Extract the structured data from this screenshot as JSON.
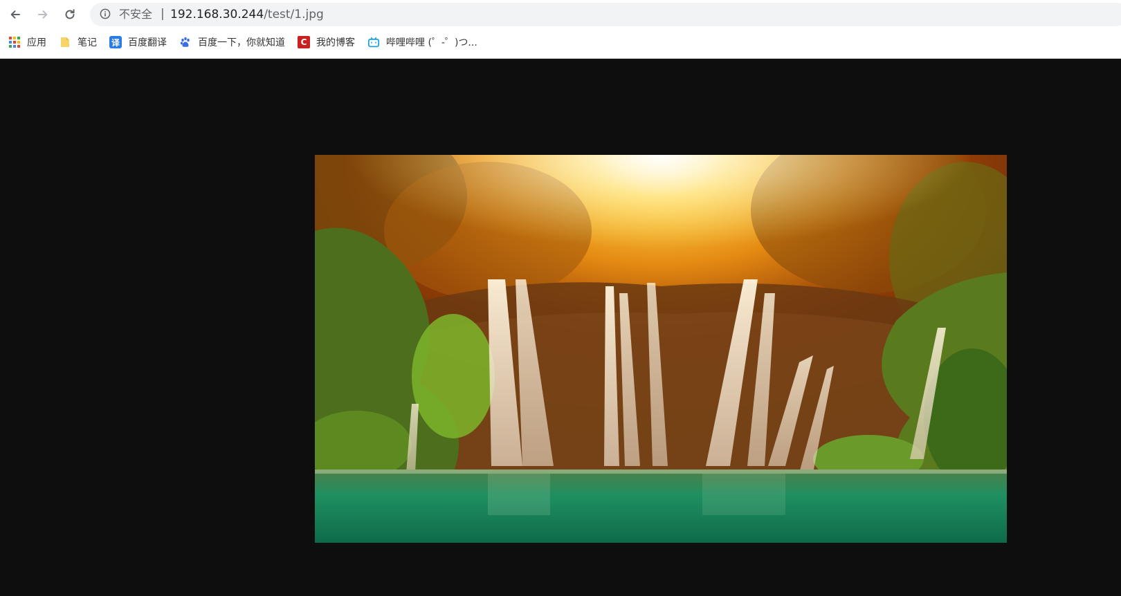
{
  "toolbar": {
    "back_icon": "arrow-left-icon",
    "forward_icon": "arrow-right-icon",
    "reload_icon": "reload-icon"
  },
  "omnibox": {
    "security_icon": "info-icon",
    "security_label": "不安全",
    "separator": "|",
    "url_host": "192.168.30.244",
    "url_path": "/test/1.jpg"
  },
  "bookmarks": [
    {
      "label": "应用",
      "icon": "apps-grid-icon"
    },
    {
      "label": "笔记",
      "icon": "folder-icon"
    },
    {
      "label": "百度翻译",
      "icon": "translate-icon",
      "icon_text": "译",
      "color": "#2b7be4"
    },
    {
      "label": "百度一下，你就知道",
      "icon": "baidu-paw-icon",
      "color": "#3a6fe0"
    },
    {
      "label": "我的博客",
      "icon": "csdn-icon",
      "icon_text": "C",
      "color": "#c9211e"
    },
    {
      "label": "哔哩哔哩 (゜-゜)つ...",
      "icon": "bilibili-tv-icon",
      "color": "#20a0d8"
    }
  ],
  "viewer": {
    "background": "#0e0e0e",
    "image_subject": "waterfall-forest-photo"
  }
}
